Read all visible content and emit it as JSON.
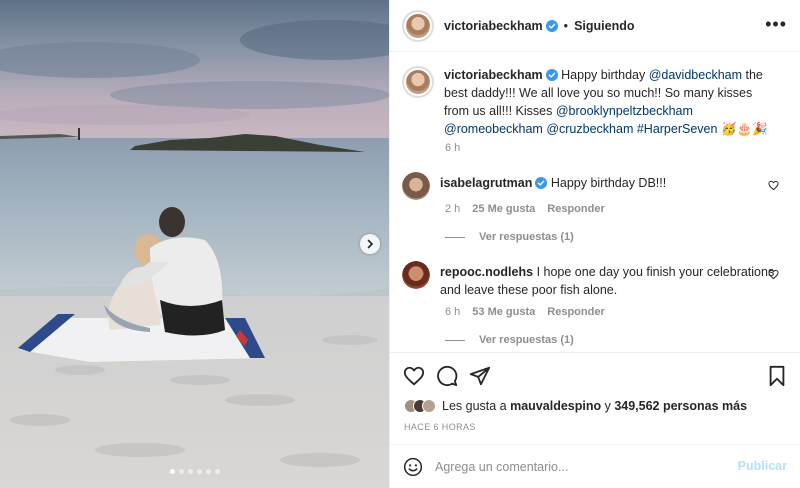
{
  "post": {
    "author": "victoriabeckham",
    "follow_state": "Siguiendo",
    "more_glyph": "•••",
    "separator": "•",
    "carousel": {
      "slides": 6,
      "active_index": 0,
      "next_icon": "chevron-right-icon"
    }
  },
  "caption": {
    "username": "victoriabeckham",
    "t1": "Happy birthday ",
    "m_david": "@davidbeckham",
    "t2": " the best daddy!!! We all love you so much!! So many kisses from us all!!! Kisses ",
    "m_brooklyn": "@brooklynpeltzbeckham",
    "m_romeo": "@romeobeckham",
    "m_cruz": "@cruzbeckham",
    "m_harper": "#HarperSeven",
    "emoji": "🥳🎂🎉",
    "time": "6 h"
  },
  "comments": [
    {
      "username": "isabelagrutman",
      "verified": true,
      "text": "Happy birthday DB!!!",
      "time": "2 h",
      "likes": "25 Me gusta",
      "reply": "Responder",
      "view_replies": "Ver respuestas (1)"
    },
    {
      "username": "repooc.nodlehs",
      "verified": false,
      "text": "I hope one day you finish your celebrations and leave these poor fish alone.",
      "time": "6 h",
      "likes": "53 Me gusta",
      "reply": "Responder",
      "view_replies": "Ver respuestas (1)"
    }
  ],
  "engagement": {
    "likes_prefix": "Les gusta a ",
    "liked_by": "mauvaldespino",
    "likes_mid": " y ",
    "others": "349,562 personas más",
    "posted_ago": "HACE 6 HORAS"
  },
  "composer": {
    "placeholder": "Agrega un comentario...",
    "publish_label": "Publicar"
  },
  "colors": {
    "link": "#00376b",
    "verified_badge": "#3897f0",
    "publish_disabled": "#b2dffc",
    "muted_text": "#8e8e8e"
  },
  "icons": [
    "heart-icon",
    "comment-icon",
    "share-icon",
    "bookmark-icon",
    "emoji-icon",
    "verified-badge-icon",
    "more-options-icon",
    "chevron-right-icon"
  ]
}
